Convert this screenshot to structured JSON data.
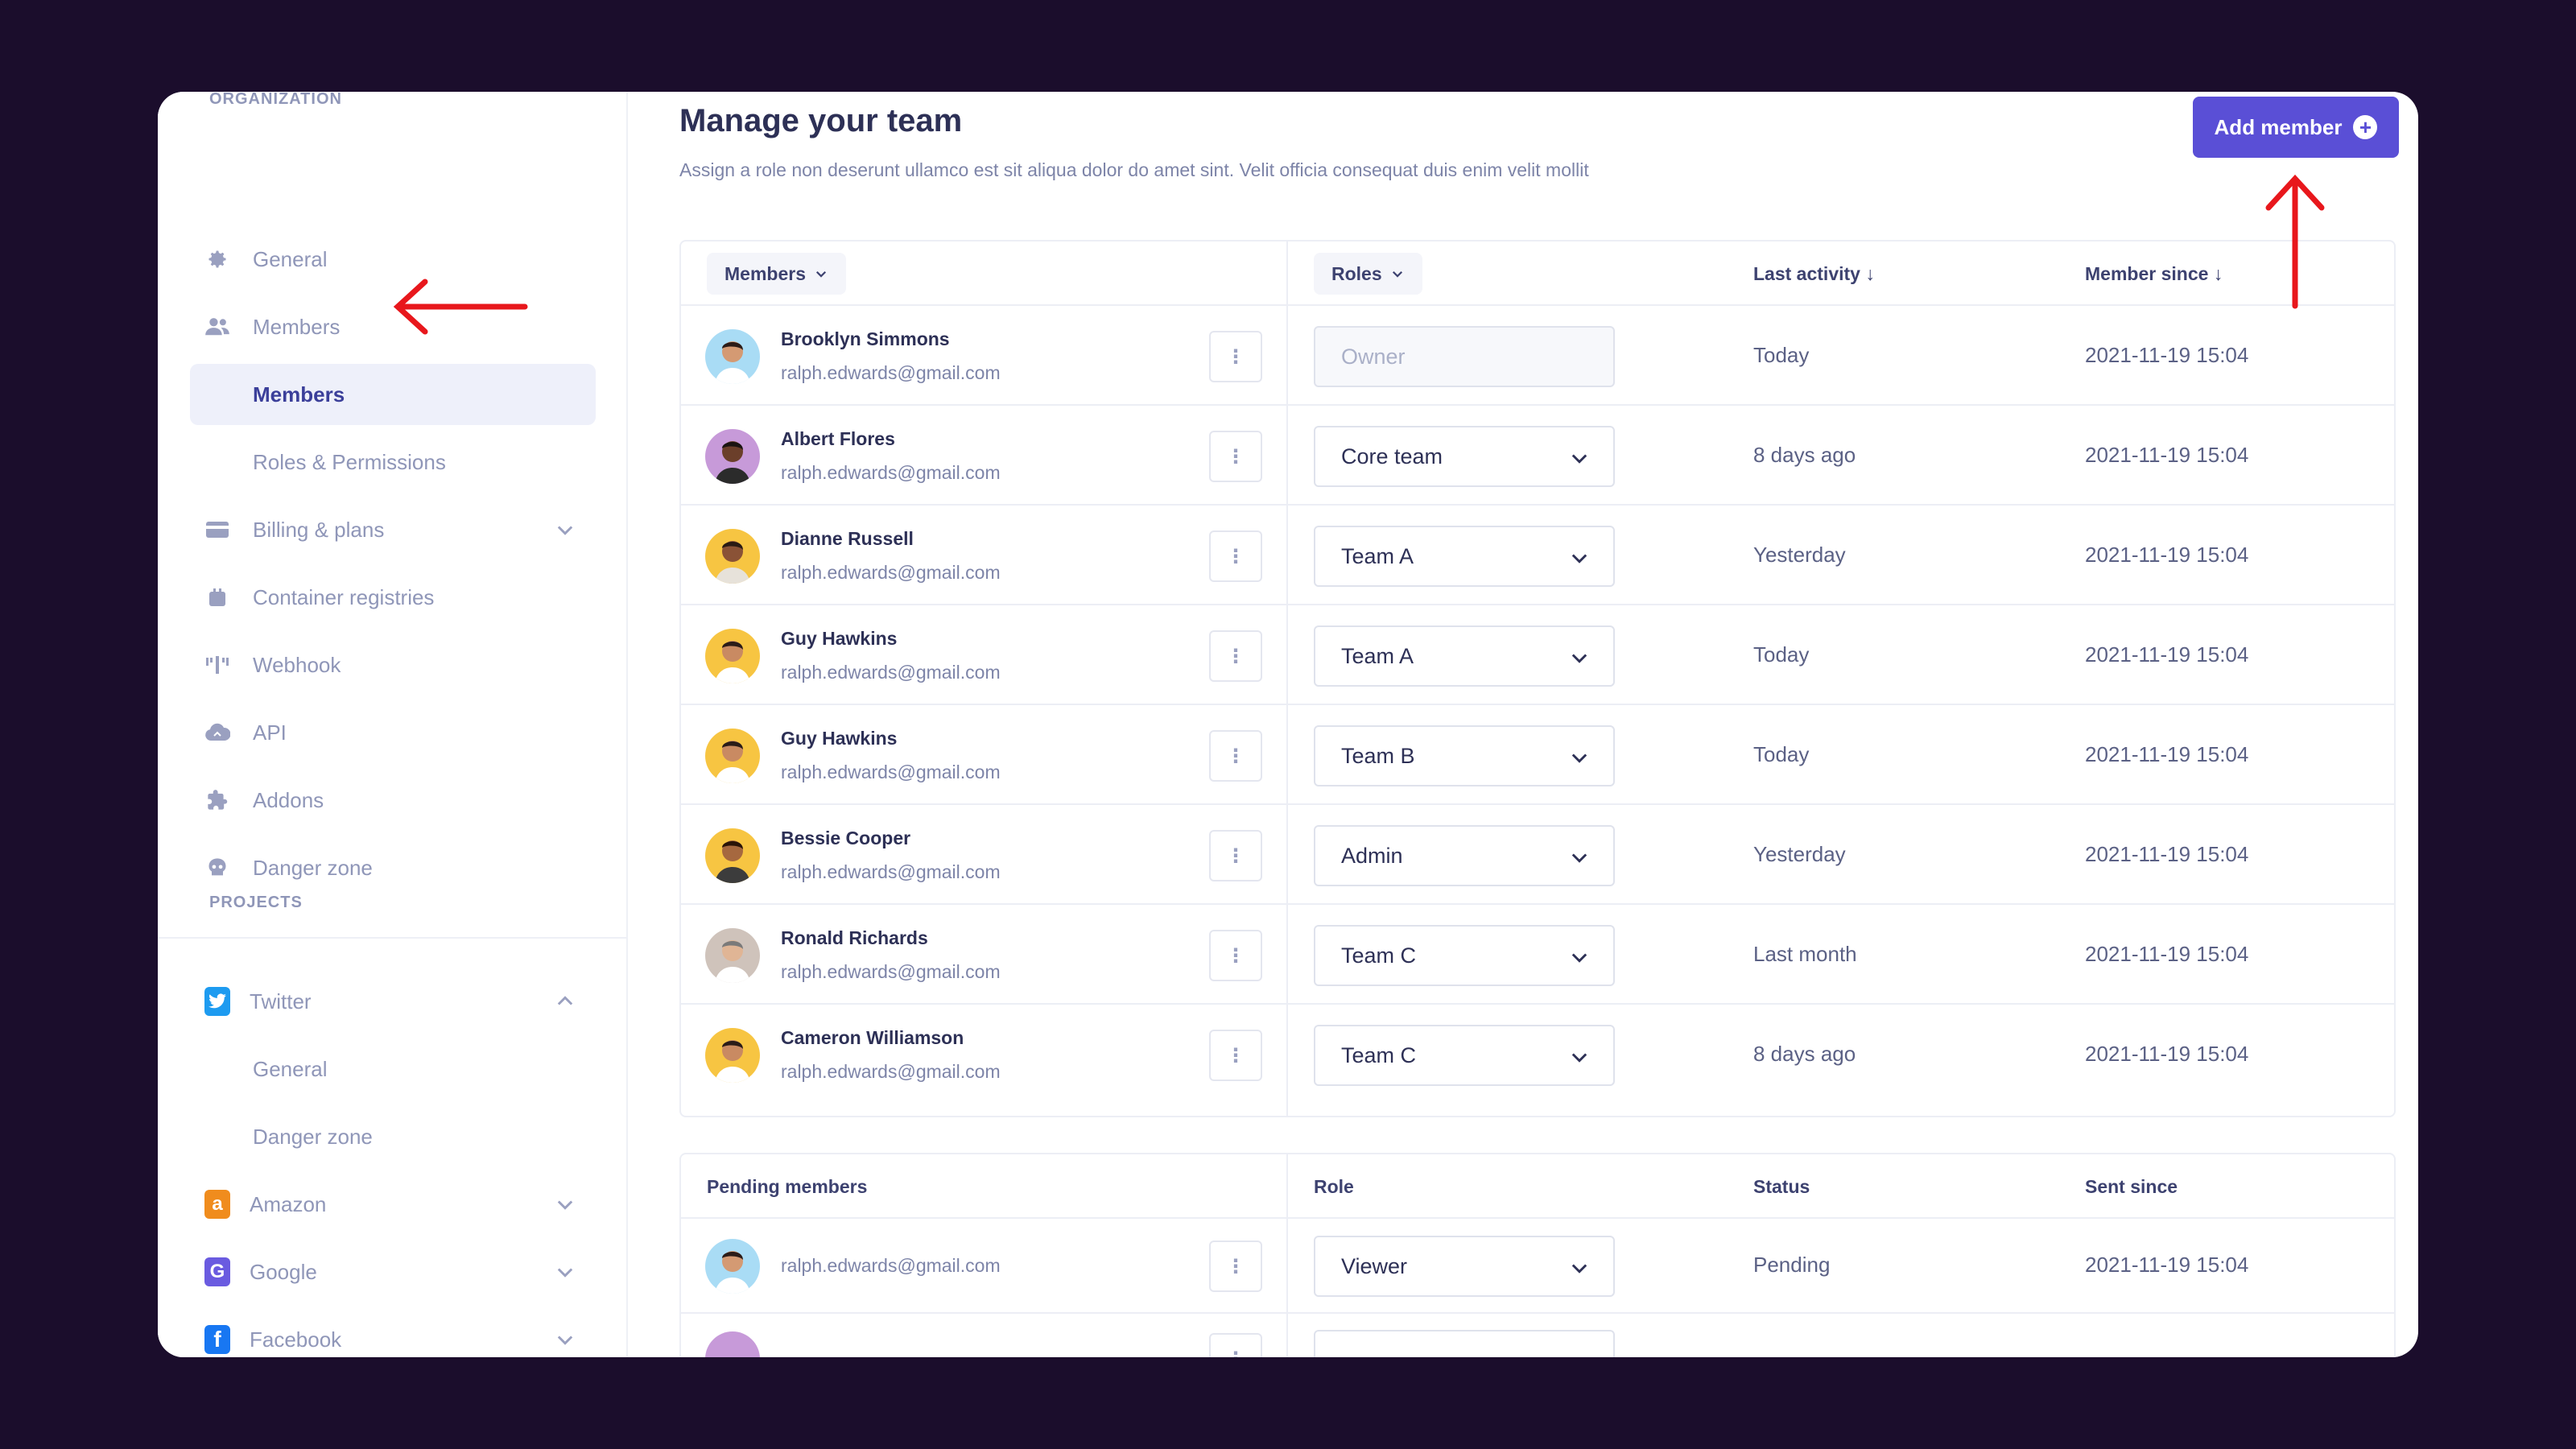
{
  "sidebar": {
    "org_title": "ORGANIZATION",
    "items": [
      {
        "label": "General",
        "icon": "gear-icon"
      },
      {
        "label": "Members",
        "icon": "users-icon"
      },
      {
        "label": "Members",
        "active": true
      },
      {
        "label": "Roles & Permissions"
      },
      {
        "label": "Billing & plans",
        "icon": "credit-card-icon"
      },
      {
        "label": "Container registries",
        "icon": "container-icon"
      },
      {
        "label": "Webhook",
        "icon": "webhook-icon"
      },
      {
        "label": "API",
        "icon": "cloud-icon"
      },
      {
        "label": "Addons",
        "icon": "puzzle-icon"
      },
      {
        "label": "Danger zone",
        "icon": "skull-icon"
      }
    ],
    "projects_title": "PROJECTS",
    "projects": [
      {
        "label": "Twitter",
        "badge": "twitter-icon",
        "color": "#1d9bf0"
      },
      {
        "label": "General"
      },
      {
        "label": "Danger zone"
      },
      {
        "label": "Amazon",
        "badge": "amazon-icon",
        "color": "#f08c1d"
      },
      {
        "label": "Google",
        "badge": "google-icon",
        "color": "#6a5be0"
      },
      {
        "label": "Facebook",
        "badge": "facebook-icon",
        "color": "#1877f2"
      }
    ]
  },
  "header": {
    "title": "Manage your team",
    "description": "Assign a role non deserunt ullamco est sit aliqua dolor do amet sint. Velit officia consequat duis enim velit mollit",
    "add_button": "Add member"
  },
  "members_table": {
    "columns": [
      "Members",
      "Roles",
      "Last activity ↓",
      "Member since ↓"
    ],
    "rows": [
      {
        "name": "Brooklyn Simmons",
        "email": "ralph.edwards@gmail.com",
        "role": "Owner",
        "last_activity": "Today",
        "since": "2021-11-19 15:04"
      },
      {
        "name": "Albert Flores",
        "email": "ralph.edwards@gmail.com",
        "role": "Core team",
        "last_activity": "8 days ago",
        "since": "2021-11-19 15:04"
      },
      {
        "name": "Dianne Russell",
        "email": "ralph.edwards@gmail.com",
        "role": "Team A",
        "last_activity": "Yesterday",
        "since": "2021-11-19 15:04"
      },
      {
        "name": "Guy Hawkins",
        "email": "ralph.edwards@gmail.com",
        "role": "Team A",
        "last_activity": "Today",
        "since": "2021-11-19 15:04"
      },
      {
        "name": "Guy Hawkins",
        "email": "ralph.edwards@gmail.com",
        "role": "Team B",
        "last_activity": "Today",
        "since": "2021-11-19 15:04"
      },
      {
        "name": "Bessie Cooper",
        "email": "ralph.edwards@gmail.com",
        "role": "Admin",
        "last_activity": "Yesterday",
        "since": "2021-11-19 15:04"
      },
      {
        "name": "Ronald Richards",
        "email": "ralph.edwards@gmail.com",
        "role": "Team C",
        "last_activity": "Last month",
        "since": "2021-11-19 15:04"
      },
      {
        "name": "Cameron Williamson",
        "email": "ralph.edwards@gmail.com",
        "role": "Team C",
        "last_activity": "8 days ago",
        "since": "2021-11-19 15:04"
      }
    ]
  },
  "pending_table": {
    "columns": [
      "Pending members",
      "Role",
      "Status",
      "Sent since"
    ],
    "rows": [
      {
        "email": "ralph.edwards@gmail.com",
        "role": "Viewer",
        "status": "Pending",
        "since": "2021-11-19 15:04"
      }
    ]
  },
  "colors": {
    "background": "#1b0d2c",
    "accent": "#5a4fd6",
    "annotation": "#e8171c"
  }
}
